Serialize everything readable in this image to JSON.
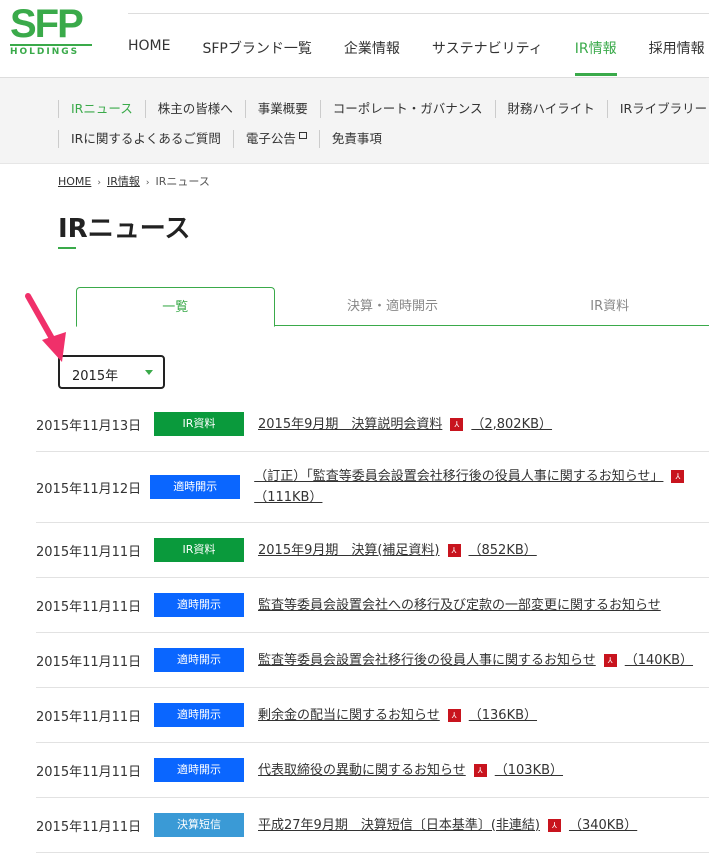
{
  "logo": {
    "main": "SFP",
    "sub": "HOLDINGS"
  },
  "gnav": [
    "HOME",
    "SFPブランド一覧",
    "企業情報",
    "サステナビリティ",
    "IR情報",
    "採用情報"
  ],
  "subnav": {
    "row1": [
      "IRニュース",
      "株主の皆様へ",
      "事業概要",
      "コーポレート・ガバナンス",
      "財務ハイライト",
      "IRライブラリー"
    ],
    "row2": [
      "IRに関するよくあるご質問",
      "電子公告",
      "免責事項"
    ]
  },
  "breadcrumb": [
    "HOME",
    "IR情報",
    "IRニュース"
  ],
  "page_title": "IRニュース",
  "tabs": [
    "一覧",
    "決算・適時開示",
    "IR資料"
  ],
  "year_select": "2015年",
  "colors": {
    "ir": "#0a9a3c",
    "tekiji": "#0a66ff",
    "kessan": "#3a9ad6"
  },
  "news": [
    {
      "date": "2015年11月13日",
      "badge": "IR資料",
      "type": "ir",
      "title": "2015年9月期　決算説明会資料",
      "size": "（2,802KB）"
    },
    {
      "date": "2015年11月12日",
      "badge": "適時開示",
      "type": "tekiji",
      "title": "（訂正）「監査等委員会設置会社移行後の役員人事に関するお知らせ」",
      "size": "（111KB）"
    },
    {
      "date": "2015年11月11日",
      "badge": "IR資料",
      "type": "ir",
      "title": "2015年9月期　決算(補足資料)",
      "size": "（852KB）"
    },
    {
      "date": "2015年11月11日",
      "badge": "適時開示",
      "type": "tekiji",
      "title": "監査等委員会設置会社への移行及び定款の一部変更に関するお知らせ",
      "size": ""
    },
    {
      "date": "2015年11月11日",
      "badge": "適時開示",
      "type": "tekiji",
      "title": "監査等委員会設置会社移行後の役員人事に関するお知らせ",
      "size": "（140KB）"
    },
    {
      "date": "2015年11月11日",
      "badge": "適時開示",
      "type": "tekiji",
      "title": "剰余金の配当に関するお知らせ",
      "size": "（136KB）"
    },
    {
      "date": "2015年11月11日",
      "badge": "適時開示",
      "type": "tekiji",
      "title": "代表取締役の異動に関するお知らせ",
      "size": "（103KB）"
    },
    {
      "date": "2015年11月11日",
      "badge": "決算短信",
      "type": "kessan",
      "title": "平成27年9月期　決算短信〔日本基準〕(非連結)",
      "size": "（340KB）"
    }
  ]
}
